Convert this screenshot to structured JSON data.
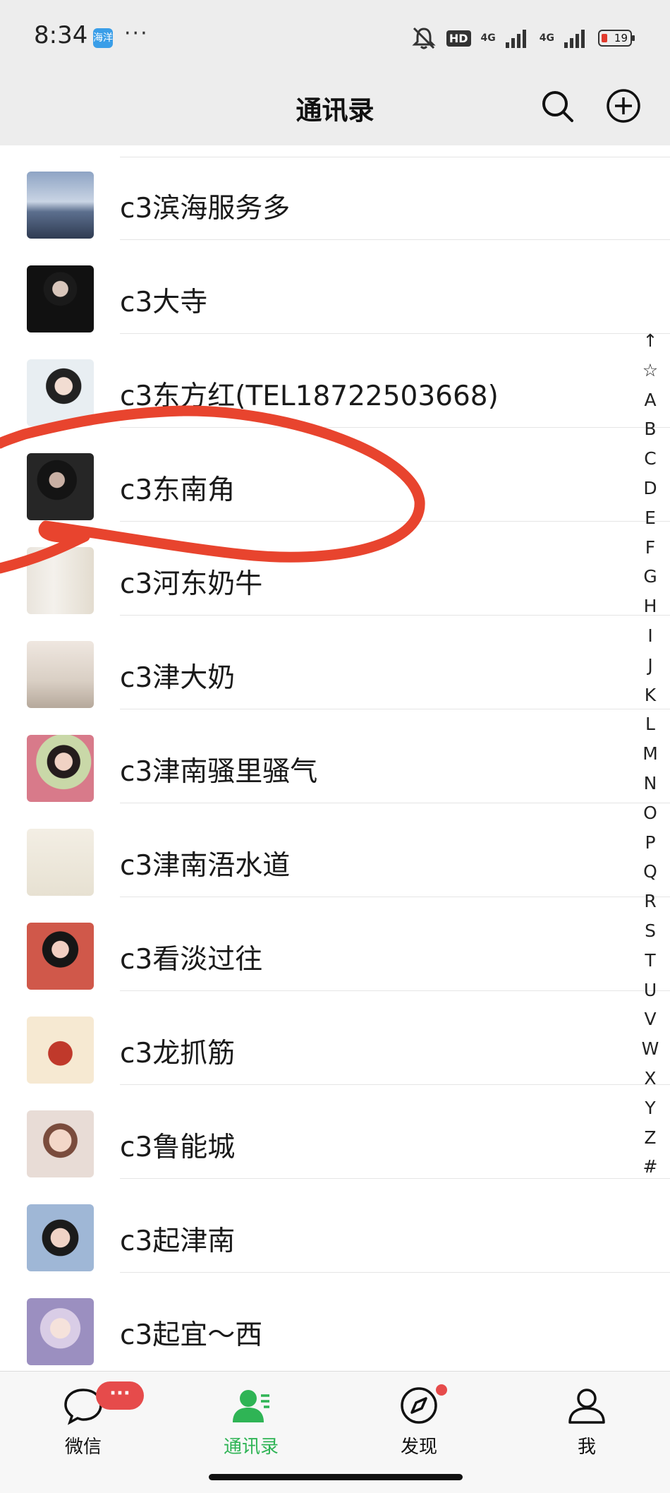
{
  "status_bar": {
    "time": "8:34",
    "app_badge": "海洋",
    "more": "···",
    "hd": "HD",
    "net1": "4G",
    "net2": "4G",
    "battery": "19"
  },
  "header": {
    "title": "通讯录",
    "search_icon": "search-icon",
    "add_icon": "add-circle-icon"
  },
  "contacts": [
    {
      "name": "c3滨海服务多",
      "avatar": "avatar-beach"
    },
    {
      "name": "c3大寺",
      "avatar": "avatar-girl-dark"
    },
    {
      "name": "c3东方红(TEL18722503668)",
      "avatar": "avatar-girl-white"
    },
    {
      "name": "c3东南角",
      "avatar": "avatar-selfie"
    },
    {
      "name": "c3河东奶牛",
      "avatar": "avatar-dress"
    },
    {
      "name": "c3津大奶",
      "avatar": "avatar-shop"
    },
    {
      "name": "c3津南骚里骚气",
      "avatar": "avatar-woman-flowers"
    },
    {
      "name": "c3津南浯水道",
      "avatar": "avatar-cartoon-sticker"
    },
    {
      "name": "c3看淡过往",
      "avatar": "avatar-woman-red"
    },
    {
      "name": "c3龙抓筋",
      "avatar": "avatar-illustration"
    },
    {
      "name": "c3鲁能城",
      "avatar": "avatar-face-filter"
    },
    {
      "name": "c3起津南",
      "avatar": "avatar-glasses"
    },
    {
      "name": "c3起宜～西",
      "avatar": "avatar-anime"
    }
  ],
  "index_letters": [
    "↑",
    "☆",
    "A",
    "B",
    "C",
    "D",
    "E",
    "F",
    "G",
    "H",
    "I",
    "J",
    "K",
    "L",
    "M",
    "N",
    "O",
    "P",
    "Q",
    "R",
    "S",
    "T",
    "U",
    "V",
    "W",
    "X",
    "Y",
    "Z",
    "#"
  ],
  "tabs": [
    {
      "label": "微信",
      "badge": "···",
      "icon": "chat-icon"
    },
    {
      "label": "通讯录",
      "icon": "contacts-icon",
      "active": true
    },
    {
      "label": "发现",
      "icon": "compass-icon"
    },
    {
      "label": "我",
      "icon": "person-icon"
    }
  ],
  "colors": {
    "accent": "#2fb455",
    "badge_red": "#e64b4b",
    "annotation_red": "#e8442e",
    "header_bg": "#ededed"
  }
}
